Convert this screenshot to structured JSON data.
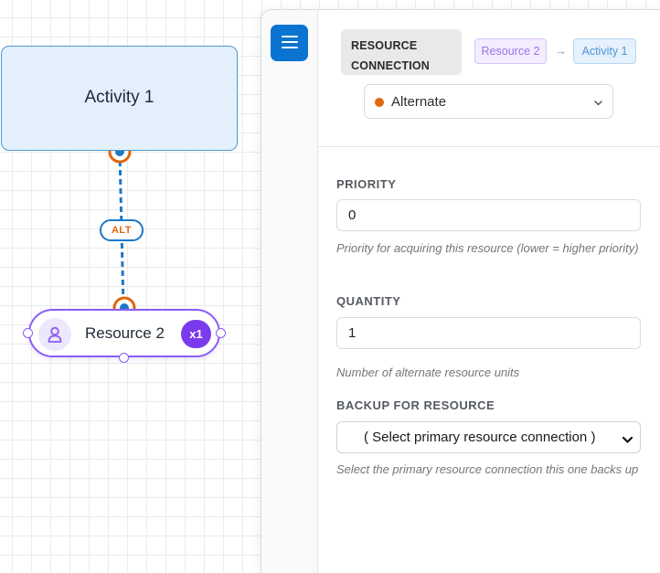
{
  "canvas": {
    "activity_node": {
      "label": "Activity 1"
    },
    "edge": {
      "badge": "ALT",
      "color": "#1d78c8",
      "handle_color": "#e0660f"
    },
    "resource_node": {
      "label": "Resource 2",
      "count": "x1",
      "icon": "person-icon",
      "accent": "#8b5cf6"
    }
  },
  "panel": {
    "menu_icon": "hamburger-icon",
    "header": {
      "type_label": "RESOURCE CONNECTION",
      "source": "Resource 2",
      "arrow": "→",
      "target": "Activity 1"
    },
    "role_select": {
      "value": "Alternate",
      "dot_color": "#e0660f"
    },
    "fields": {
      "priority": {
        "label": "PRIORITY",
        "value": "0",
        "help": "Priority for acquiring this resource (lower = higher priority)"
      },
      "quantity": {
        "label": "QUANTITY",
        "value": "1",
        "help": "Number of alternate resource units"
      },
      "backup": {
        "label": "BACKUP FOR RESOURCE",
        "value": "( Select primary resource connection )",
        "help": "Select the primary resource connection this one backs up"
      }
    }
  }
}
